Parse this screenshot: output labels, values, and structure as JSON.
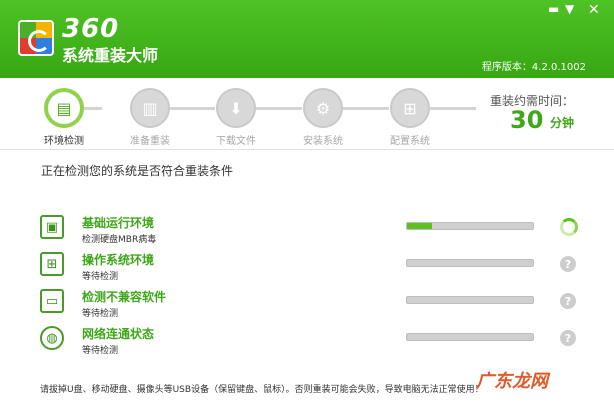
{
  "header": {
    "logo_number": "360",
    "logo_name": "系统重装大师",
    "version": "程序版本：4.2.0.1002"
  },
  "window_controls": {
    "minimize": "▬",
    "menu": "▼",
    "close": "✕"
  },
  "steps": [
    {
      "label": "环境检测",
      "icon": "checklist-icon",
      "active": true
    },
    {
      "label": "准备重装",
      "icon": "document-icon",
      "active": false
    },
    {
      "label": "下载文件",
      "icon": "download-icon",
      "active": false
    },
    {
      "label": "安装系统",
      "icon": "gear-icon",
      "active": false
    },
    {
      "label": "配置系统",
      "icon": "windows-icon",
      "active": false
    }
  ],
  "time": {
    "label": "重装约需时间：",
    "value": "30",
    "unit": "分钟"
  },
  "section_title": "正在检测您的系统是否符合重装条件",
  "checks": [
    {
      "title": "基础运行环境",
      "status": "检测硬盘MBR病毒",
      "icon": "computer-icon",
      "progress": 0.2,
      "state": "running"
    },
    {
      "title": "操作系统环境",
      "status": "等待检测",
      "icon": "windows-icon",
      "progress": 0,
      "state": "waiting"
    },
    {
      "title": "检测不兼容软件",
      "status": "等待检测",
      "icon": "monitor-icon",
      "progress": 0,
      "state": "waiting"
    },
    {
      "title": "网络连通状态",
      "status": "等待检测",
      "icon": "globe-icon",
      "progress": 0,
      "state": "waiting"
    }
  ],
  "footer": "请拔掉U盘、移动硬盘、摄像头等USB设备（保留键盘、鼠标）。否则重装可能会失败，导致电脑无法正常使用！",
  "watermark": "广东龙网",
  "colors": {
    "brand_green": "#3fa71a",
    "header_green": "#4fc226",
    "progress_green": "#5dc21e"
  }
}
